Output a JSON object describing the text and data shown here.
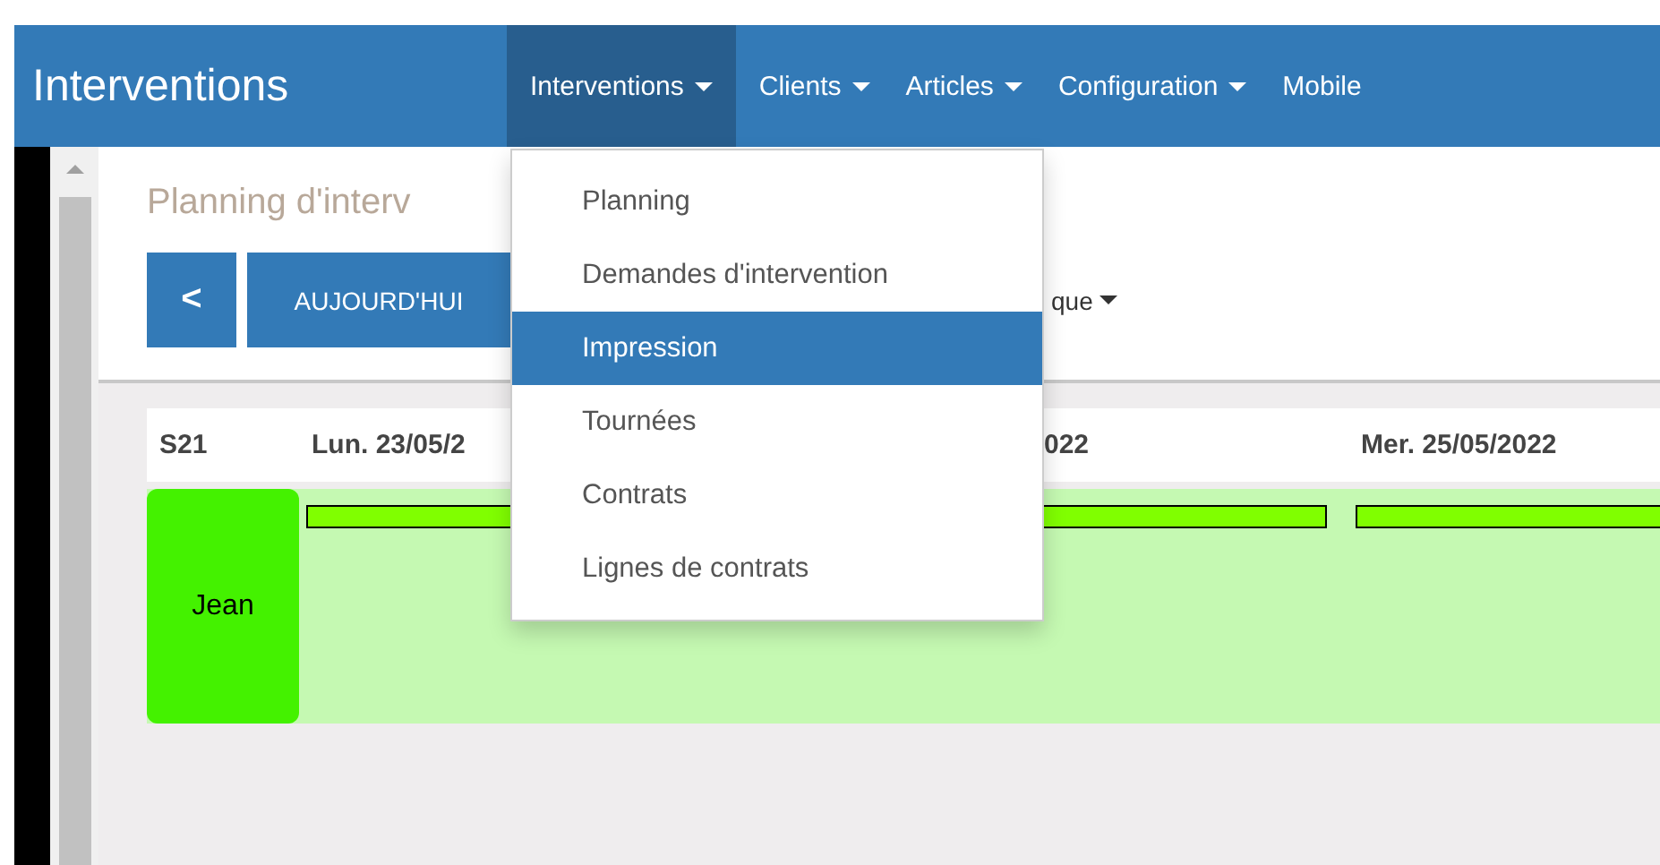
{
  "navbar": {
    "brand": "Interventions",
    "items": [
      {
        "label": "Interventions",
        "dropdown": true,
        "selected": true
      },
      {
        "label": "Clients",
        "dropdown": true,
        "selected": false
      },
      {
        "label": "Articles",
        "dropdown": true,
        "selected": false
      },
      {
        "label": "Configuration",
        "dropdown": true,
        "selected": false
      },
      {
        "label": "Mobile",
        "dropdown": false,
        "selected": false
      }
    ]
  },
  "dropdown_menu": {
    "items": [
      {
        "label": "Planning",
        "selected": false
      },
      {
        "label": "Demandes d'intervention",
        "selected": false
      },
      {
        "label": "Impression",
        "selected": true
      },
      {
        "label": "Tournées",
        "selected": false
      },
      {
        "label": "Contrats",
        "selected": false
      },
      {
        "label": "Lignes de contrats",
        "selected": false
      }
    ]
  },
  "page": {
    "title": "Planning d'interv",
    "toolbar": {
      "prev_button": "<",
      "today_button": "AUJOURD'HUI",
      "view_menu": "que"
    }
  },
  "planning": {
    "week": "S21",
    "days": [
      {
        "label": "Lun. 23/05/2",
        "event": true
      },
      {
        "label": "022",
        "event": true
      },
      {
        "label": "Mer. 25/05/2022",
        "event": true
      }
    ],
    "resources": [
      {
        "name": "Jean",
        "color": "#44f200"
      }
    ]
  }
}
